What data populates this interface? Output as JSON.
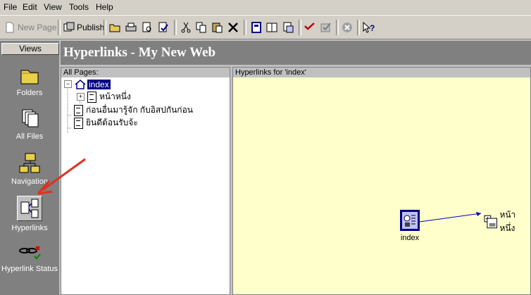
{
  "menu": [
    "File",
    "Edit",
    "View",
    "Tools",
    "Help"
  ],
  "toolbar": {
    "new_page": "New Page",
    "publish": "Publish"
  },
  "views": {
    "header": "Views",
    "items": [
      {
        "label": "Folders",
        "icon": "folder-icon"
      },
      {
        "label": "All Files",
        "icon": "files-icon"
      },
      {
        "label": "Navigation",
        "icon": "navigation-icon"
      },
      {
        "label": "Hyperlinks",
        "icon": "hyperlinks-icon",
        "selected": true
      },
      {
        "label": "Hyperlink Status",
        "icon": "hyperlink-status-icon"
      }
    ]
  },
  "title": "Hyperlinks - My New Web",
  "tree": {
    "label": "All Pages:",
    "items": [
      {
        "label": "index",
        "level": 0,
        "expander": "−",
        "selected": true
      },
      {
        "label": "หน้าหนึ่ง",
        "level": 1,
        "expander": "+"
      },
      {
        "label": "ก่อนอื่นมารู้จัก กับอิสปกันก่อน",
        "level": 0
      },
      {
        "label": "ยินดีต้อนรับจ้ะ",
        "level": 0
      }
    ]
  },
  "graph": {
    "label": "Hyperlinks for 'index'",
    "center": "index",
    "target": "หน้าหนึ่ง"
  },
  "colors": {
    "accent": "#000080",
    "pane_bg": "#ffffcc",
    "link": "#0000c0",
    "annotation": "#e03020"
  }
}
